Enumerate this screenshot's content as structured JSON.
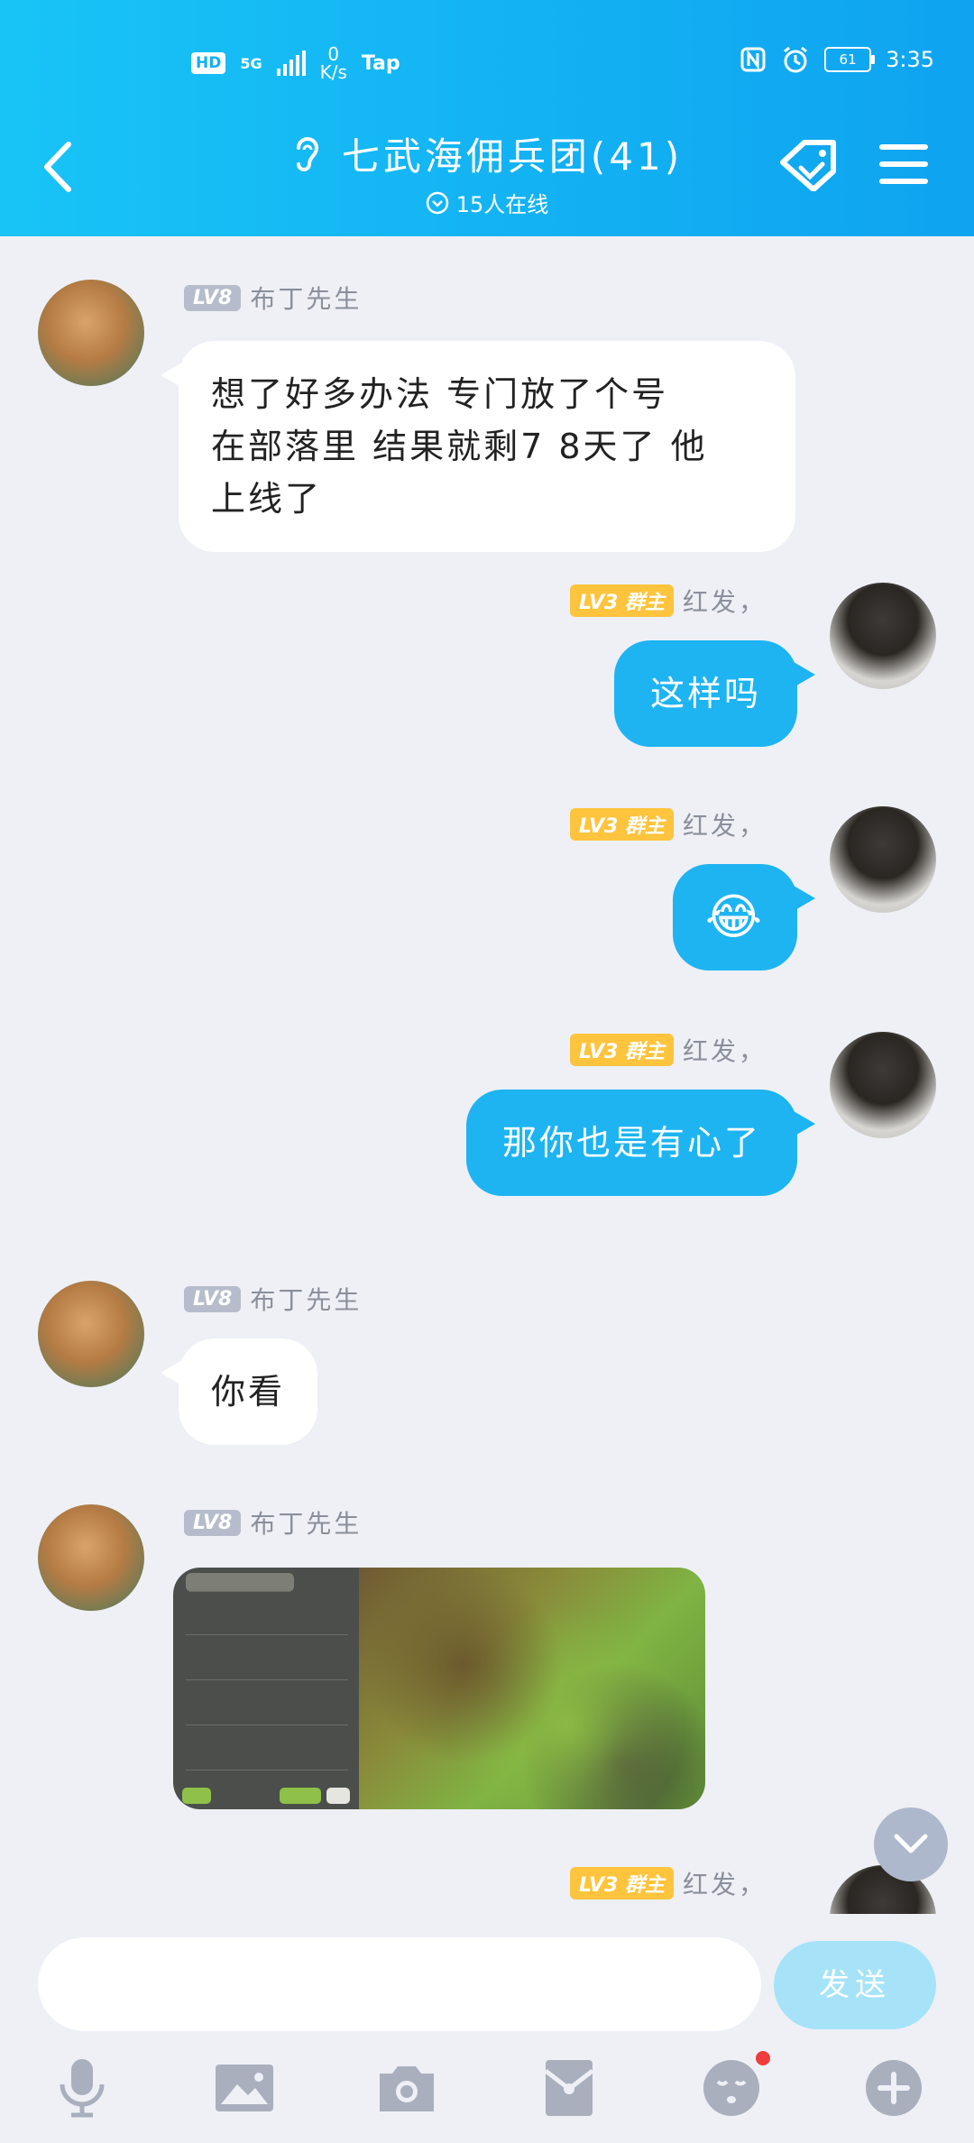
{
  "status_bar": {
    "hd": "HD",
    "network": "5G",
    "speed_value": "0",
    "speed_unit": "K/s",
    "tap": "Tap",
    "battery": "61",
    "time": "3:35"
  },
  "header": {
    "title": "七武海佣兵团(41)",
    "online": "15人在线"
  },
  "messages": [
    {
      "side": "left",
      "level": "LV8",
      "sender": "布丁先生",
      "text_lines": [
        "想了好多办法 专门放了个号",
        "在部落里 结果就剩7 8天了 他",
        "上线了"
      ]
    },
    {
      "side": "right",
      "level": "LV3 群主",
      "sender": "红发，",
      "text": "这样吗"
    },
    {
      "side": "right",
      "level": "LV3 群主",
      "sender": "红发，",
      "text": "😂"
    },
    {
      "side": "right",
      "level": "LV3 群主",
      "sender": "红发，",
      "text": "那你也是有心了"
    },
    {
      "side": "left",
      "level": "LV8",
      "sender": "布丁先生",
      "text": "你看"
    },
    {
      "side": "left",
      "level": "LV8",
      "sender": "布丁先生",
      "image": "game-screenshot"
    },
    {
      "side": "right",
      "level": "LV3 群主",
      "sender": "红发，",
      "text": ""
    }
  ],
  "input": {
    "value": "",
    "send_label": "发送"
  },
  "toolbar": {
    "icons": [
      "microphone-icon",
      "image-icon",
      "camera-icon",
      "red-packet-icon",
      "emoji-icon",
      "plus-icon"
    ],
    "badge_color": "#f03c3c"
  },
  "colors": {
    "header": "#14b0f2",
    "bubble_self": "#1eb4f2",
    "bubble_other": "#ffffff",
    "owner_badge": "#ffc43d",
    "level_badge": "#b6bccb"
  }
}
